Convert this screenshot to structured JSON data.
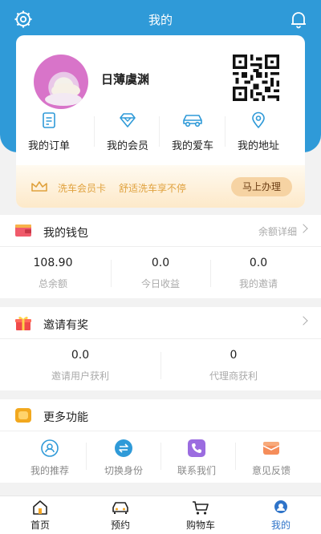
{
  "header": {
    "title": "我的",
    "settings_icon": "settings-gear-icon",
    "notification_icon": "bell-icon"
  },
  "colors": {
    "primary": "#2f9ad8",
    "accent_gold": "#e0a23e",
    "tab_active": "#2f74c9"
  },
  "profile": {
    "username": "日薄虞渊",
    "avatar_icon": "avatar-image",
    "qr_icon": "qr-code-icon"
  },
  "quick_links": [
    {
      "label": "我的订单",
      "icon": "order-doc-icon"
    },
    {
      "label": "我的会员",
      "icon": "diamond-icon"
    },
    {
      "label": "我的爱车",
      "icon": "car-icon"
    },
    {
      "label": "我的地址",
      "icon": "location-pin-icon"
    }
  ],
  "vip_banner": {
    "title": "洗车会员卡",
    "subtitle": "舒适洗车享不停",
    "button": "马上办理",
    "icon": "crown-icon"
  },
  "wallet": {
    "title": "我的钱包",
    "link": "余额详细",
    "stats": [
      {
        "value": "108.90",
        "label": "总余额"
      },
      {
        "value": "0.0",
        "label": "今日收益"
      },
      {
        "value": "0.0",
        "label": "我的邀请"
      }
    ]
  },
  "invite": {
    "title": "邀请有奖",
    "stats": [
      {
        "value": "0.0",
        "label": "邀请用户获利"
      },
      {
        "value": "0",
        "label": "代理商获利"
      }
    ]
  },
  "more": {
    "title": "更多功能",
    "items": [
      {
        "label": "我的推荐",
        "icon": "user-recommend-icon"
      },
      {
        "label": "切换身份",
        "icon": "switch-arrows-icon"
      },
      {
        "label": "联系我们",
        "icon": "phone-icon"
      },
      {
        "label": "意见反馈",
        "icon": "envelope-icon"
      }
    ]
  },
  "tabbar": [
    {
      "label": "首页",
      "icon": "home-icon"
    },
    {
      "label": "预约",
      "icon": "car-front-icon"
    },
    {
      "label": "购物车",
      "icon": "cart-icon"
    },
    {
      "label": "我的",
      "icon": "profile-icon",
      "active": true
    }
  ]
}
